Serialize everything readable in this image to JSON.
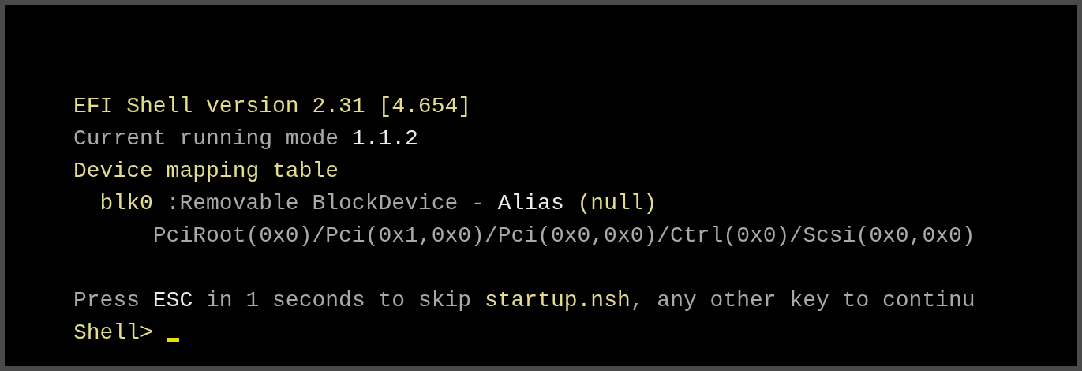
{
  "console": {
    "lines": [
      {
        "kind": "text",
        "cursor": false,
        "segments": [
          {
            "text": "EFI Shell version 2.31 [4.654]",
            "color": "#e2dc8c"
          }
        ]
      },
      {
        "kind": "text",
        "cursor": false,
        "segments": [
          {
            "text": "Current running mode ",
            "color": "#a9a9a9"
          },
          {
            "text": "1.1.2",
            "color": "#ececec"
          }
        ]
      },
      {
        "kind": "text",
        "cursor": false,
        "segments": [
          {
            "text": "Device mapping table",
            "color": "#e2dc8c"
          }
        ]
      },
      {
        "kind": "text",
        "cursor": false,
        "segments": [
          {
            "text": "  blk0",
            "color": "#e2dc8c"
          },
          {
            "text": " :Removable BlockDevice - ",
            "color": "#a9a9a9"
          },
          {
            "text": "Alias",
            "color": "#ececec"
          },
          {
            "text": " (null)",
            "color": "#e2dc8c"
          }
        ]
      },
      {
        "kind": "text",
        "cursor": false,
        "segments": [
          {
            "text": "      PciRoot(0x0)/Pci(0x1,0x0)/Pci(0x0,0x0)/Ctrl(0x0)/Scsi(0x0,0x0)",
            "color": "#a9a9a9"
          }
        ]
      },
      {
        "kind": "blank"
      },
      {
        "kind": "text",
        "cursor": false,
        "segments": [
          {
            "text": "Press ",
            "color": "#a9a9a9"
          },
          {
            "text": "ESC",
            "color": "#ececec"
          },
          {
            "text": " in 1 seconds to skip ",
            "color": "#a9a9a9"
          },
          {
            "text": "startup.nsh",
            "color": "#e2dc8c"
          },
          {
            "text": ", any other key to continu",
            "color": "#a9a9a9"
          }
        ]
      },
      {
        "kind": "text",
        "cursor": true,
        "segments": [
          {
            "text": "Shell> ",
            "color": "#e2dc8c"
          }
        ]
      }
    ]
  }
}
